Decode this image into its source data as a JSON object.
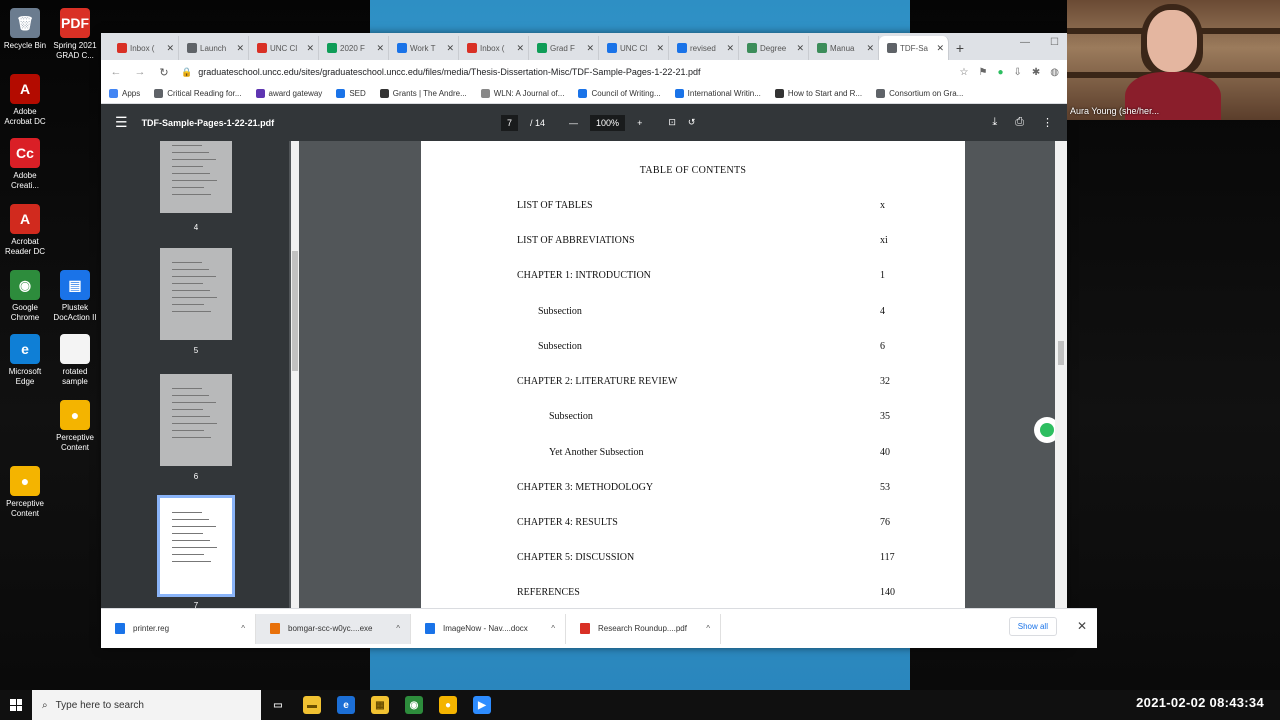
{
  "desktop": {
    "icons": [
      {
        "label": "Recycle Bin",
        "glyph": "🗑",
        "color": "#6b7c8f"
      },
      {
        "label": "Spring 2021 GRAD C...",
        "glyph": "PDF",
        "color": "#d93025"
      },
      {
        "label": "Adobe Acrobat DC",
        "glyph": "A",
        "color": "#b30b00"
      },
      {
        "label": "Adobe Creati...",
        "glyph": "Cc",
        "color": "#da1f26"
      },
      {
        "label": "Acrobat Reader DC",
        "glyph": "A",
        "color": "#d12a1e"
      },
      {
        "label": "Google Chrome",
        "glyph": "◉",
        "color": "#2d8c3c"
      },
      {
        "label": "Plustek DocAction II",
        "glyph": "▤",
        "color": "#1a73e8"
      },
      {
        "label": "Microsoft Edge",
        "glyph": "e",
        "color": "#0f7fd6"
      },
      {
        "label": "rotated sample",
        "glyph": "",
        "color": "#f4f4f4"
      },
      {
        "label": "Perceptive Content",
        "glyph": "●",
        "color": "#f4b400"
      },
      {
        "label": "Perceptive Content",
        "glyph": "●",
        "color": "#f4b400"
      }
    ]
  },
  "browser": {
    "tabs": [
      {
        "label": "Inbox (",
        "color": "#d93025"
      },
      {
        "label": "Launch",
        "color": "#5f6368"
      },
      {
        "label": "UNC Cl",
        "color": "#d93025"
      },
      {
        "label": "2020 F",
        "color": "#0f9d58"
      },
      {
        "label": "Work T",
        "color": "#1a73e8"
      },
      {
        "label": "Inbox (",
        "color": "#d93025"
      },
      {
        "label": "Grad F",
        "color": "#0f9d58"
      },
      {
        "label": "UNC Cl",
        "color": "#1a73e8"
      },
      {
        "label": "revised",
        "color": "#1a73e8"
      },
      {
        "label": "Degree",
        "color": "#3c8d5a"
      },
      {
        "label": "Manua",
        "color": "#3c8d5a"
      },
      {
        "label": "TDF-Sa",
        "color": "#5f6368"
      }
    ],
    "new_tab": "+",
    "url": "graduateschool.uncc.edu/sites/graduateschool.uncc.edu/files/media/Thesis-Dissertation-Misc/TDF-Sample-Pages-1-22-21.pdf",
    "bookmarks": [
      {
        "label": "Apps",
        "color": "#4285f4"
      },
      {
        "label": "Critical Reading for...",
        "color": "#5f6368"
      },
      {
        "label": "award gateway",
        "color": "#5e35b1"
      },
      {
        "label": "SED",
        "color": "#1a73e8"
      },
      {
        "label": "Grants | The Andre...",
        "color": "#333333"
      },
      {
        "label": "WLN: A Journal of...",
        "color": "#888888"
      },
      {
        "label": "Council of Writing...",
        "color": "#1a73e8"
      },
      {
        "label": "International Writin...",
        "color": "#1a73e8"
      },
      {
        "label": "How to Start and R...",
        "color": "#333333"
      },
      {
        "label": "Consortium on Gra...",
        "color": "#5f6368"
      }
    ]
  },
  "pdf": {
    "filename": "TDF-Sample-Pages-1-22-21.pdf",
    "current_page": "7",
    "total_pages": "/ 14",
    "zoom": "100%",
    "thumbnails": [
      "4",
      "5",
      "6",
      "7"
    ],
    "toc": {
      "title": "TABLE OF CONTENTS",
      "entries": [
        {
          "label": "LIST OF TABLES",
          "page": "x"
        },
        {
          "label": "LIST OF ABBREVIATIONS",
          "page": "xi"
        },
        {
          "label": "CHAPTER 1: INTRODUCTION",
          "page": "1"
        },
        {
          "label": "Subsection",
          "page": "4"
        },
        {
          "label": "Subsection",
          "page": "6"
        },
        {
          "label": "CHAPTER 2: LITERATURE REVIEW",
          "page": "32"
        },
        {
          "label": "Subsection",
          "page": "35"
        },
        {
          "label": "Yet Another Subsection",
          "page": "40"
        },
        {
          "label": "CHAPTER 3: METHODOLOGY",
          "page": "53"
        },
        {
          "label": "CHAPTER 4: RESULTS",
          "page": "76"
        },
        {
          "label": "CHAPTER 5: DISCUSSION",
          "page": "117"
        },
        {
          "label": "REFERENCES",
          "page": "140"
        }
      ]
    }
  },
  "downloads": {
    "items": [
      {
        "name": "printer.reg",
        "color": "#1a73e8"
      },
      {
        "name": "bomgar-scc-w0yc....exe",
        "color": "#e8710a"
      },
      {
        "name": "ImageNow - Nav....docx",
        "color": "#1a73e8"
      },
      {
        "name": "Research Roundup....pdf",
        "color": "#d93025"
      }
    ],
    "show_all": "Show all"
  },
  "webcam": {
    "name": "Aura Young (she/her..."
  },
  "taskbar": {
    "search_placeholder": "Type here to search",
    "clock": "2021-02-02 08:43:34"
  }
}
